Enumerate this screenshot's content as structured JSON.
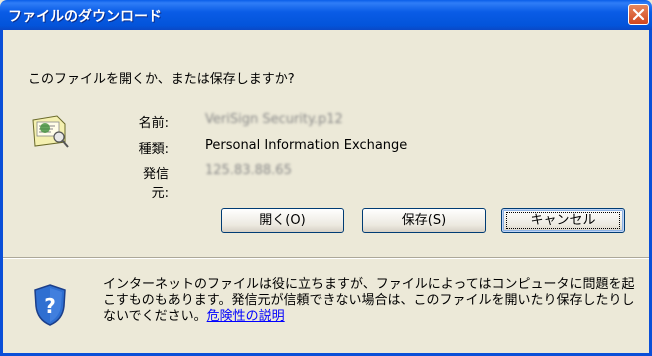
{
  "window": {
    "title": "ファイルのダウンロード"
  },
  "question": "このファイルを開くか、または保存しますか?",
  "file": {
    "name_label": "名前:",
    "name_value": "VeriSign Security.p12",
    "type_label": "種類:",
    "type_value": "Personal Information Exchange",
    "from_label": "発信元:",
    "from_value": "125.83.88.65"
  },
  "buttons": {
    "open": "開く(O)",
    "save": "保存(S)",
    "cancel": "キャンセル"
  },
  "warning": {
    "text": "インターネットのファイルは役に立ちますが、ファイルによってはコンピュータに問題を起こすものもあります。発信元が信頼できない場合は、このファイルを開いたり保存したりしないでください。",
    "link": "危険性の説明"
  },
  "icons": {
    "close": "close-icon",
    "file": "certificate-file-icon",
    "shield": "shield-question-icon"
  }
}
